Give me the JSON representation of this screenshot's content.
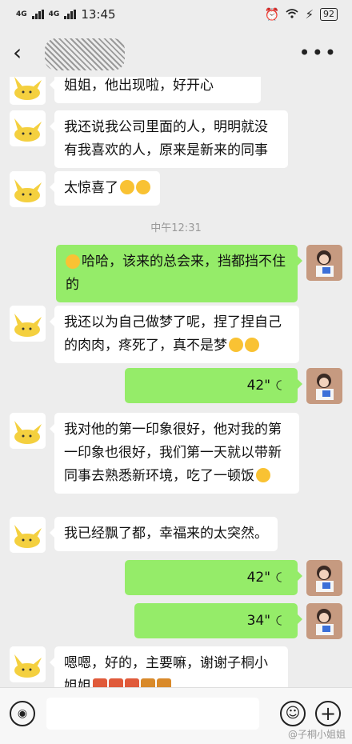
{
  "status": {
    "signal1": "4G",
    "signal2": "4G",
    "time": "13:45",
    "battery": "92"
  },
  "header": {
    "back_icon": "chevron-left-icon",
    "more_icon": "more-dots-icon"
  },
  "messages": {
    "m1": "姐姐，他出现啦，好开心",
    "m2": "我还说我公司里面的人，明明就没有我喜欢的人，原来是新来的同事",
    "m3": "太惊喜了",
    "time1": "中午12:31",
    "m4": "哈哈，该来的总会来，挡都挡不住的",
    "m5": "我还以为自己做梦了呢，捏了捏自己的肉肉，疼死了，真不是梦",
    "v1": "42\"",
    "m6": "我对他的第一印象很好，他对我的第一印象也很好，我们第一天就以带新同事去熟悉新环境，吃了一顿饭",
    "m7": "我已经飘了都，幸福来的太突然。",
    "v2": "42\"",
    "v3": "34\"",
    "m8": "嗯嗯，好的，主要嘛，谢谢子桐小姐姐"
  },
  "watermark": "@子桐小姐姐"
}
